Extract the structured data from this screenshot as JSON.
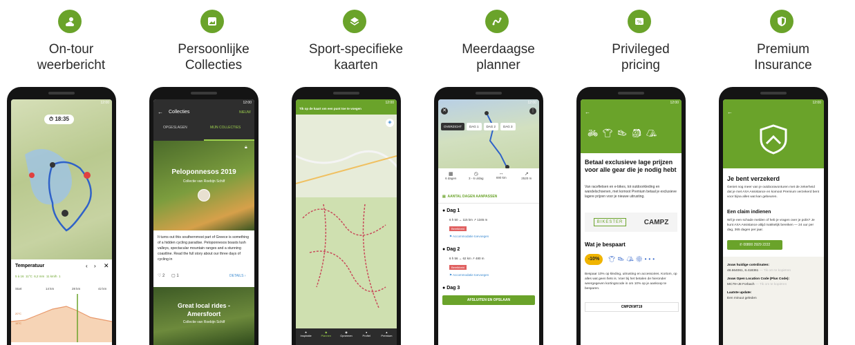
{
  "features": [
    {
      "icon": "weather-icon",
      "title_line1": "On-tour",
      "title_line2": "weerbericht"
    },
    {
      "icon": "collection-icon",
      "title_line1": "Persoonlijke",
      "title_line2": "Collecties"
    },
    {
      "icon": "layers-icon",
      "title_line1": "Sport-specifieke",
      "title_line2": "kaarten"
    },
    {
      "icon": "route-icon",
      "title_line1": "Meerdaagse",
      "title_line2": "planner"
    },
    {
      "icon": "discount-icon",
      "title_line1": "Privileged",
      "title_line2": "pricing"
    },
    {
      "icon": "shield-icon",
      "title_line1": "Premium",
      "title_line2": "Insurance"
    }
  ],
  "status_time": "12:00",
  "phone1": {
    "time_pill": "18:35",
    "panel_title": "Temperatuur",
    "stats": [
      "5 à 16",
      "11°C",
      "6,2 mm",
      "11 km/h",
      "1"
    ],
    "axis": [
      "Start",
      "14 km",
      "28 km",
      "42 km"
    ],
    "temp_labels": [
      "20°C",
      "15°C"
    ]
  },
  "phone2": {
    "header": "Collecties",
    "badge": "NIEUW",
    "tabs": [
      "OPGESLAGEN",
      "MIJN COLLECTIES"
    ],
    "card_title": "Peloponnesos 2019",
    "card_sub": "Collectie van Roebijn Schilf",
    "body": "It turns out this southernmost part of Greece is something of a hidden cycling paradise. Peloponnesos boasts lush valleys, spectacular mountain ranges and a stunning coastline. Read the full story about our three days of cycling in",
    "likes": "2",
    "comments": "1",
    "details": "DETAILS",
    "card2_title_l1": "Great local rides -",
    "card2_title_l2": "Amersfoort",
    "card2_sub": "Collectie van Roebijn Schilf"
  },
  "phone3": {
    "banner": "Tik op de kaart om een punt toe te voegen",
    "nav": [
      "Inspiratie",
      "Plannen",
      "Opnemen",
      "Profiel",
      "Premium"
    ]
  },
  "phone4": {
    "tabs": [
      "OVERZICHT",
      "DAG 1",
      "DAG 2",
      "DAG 3"
    ],
    "stats": [
      "6 dagen",
      "3 - 6 u/dag",
      "690 km",
      "2520 m"
    ],
    "adjust": "AANTAL DAGEN AANPASSEN",
    "days": [
      {
        "label": "Dag 1",
        "line": "6 h 50   ↔ 115 km   ↗ 1345 m",
        "tag": "Bereikbeid",
        "link": "Accommodatie toevoegen"
      },
      {
        "label": "Dag 2",
        "line": "6 h 56   ↔ 62 km   ↗ 480 m",
        "tag": "Bereikbeid",
        "link": "Accommodatie toevoegen"
      },
      {
        "label": "Dag 3"
      }
    ],
    "button": "AFSLUITEN EN OPSLAAN"
  },
  "phone5": {
    "heading": "Betaal exclusieve lage prijzen voor alle gear die je nodig hebt",
    "body": "Van racefietsen en e-bikes, tot outdoorkleding en wandelschoenen, met komoot Premium betaal je exclusieve lagere prijzen voor je nieuwe uitrusting.",
    "brands": [
      "BIKESTER",
      "CAMPZ"
    ],
    "saving_title": "Wat je bespaart",
    "discount": "-10%",
    "saving_body": "Bespaar 10% op kleding, uitrusting en accessoires. Kortom, op alles wat geen fiets is. Voer bij het betalen de hieronder weergegeven kortingscode in om 10% op je aankoop te besparen.",
    "code": "CMPZKMT19"
  },
  "phone6": {
    "heading": "Je bent verzekerd",
    "intro": "Geniet nog meer van je outdooravonturen met de zekerheid dat je met AXA Assistance en komoot Premium verzekerd bent voor bijna alles wat kan gebeuren.",
    "claim_title": "Een claim indienen",
    "claim_body": "Wil je een schade melden of heb je vragen over je polis? Je kunt AXA Assistance altijd makkelijk bereiken — 24 uur per dag, 365 dagen per jaar.",
    "phone": "00800 2929 2222",
    "coords_label": "Jouw huidige coördinaten:",
    "coords": "48.664061, 8.418361",
    "copy": "Tik om te kopiëren",
    "olc_label": "Jouw Open Location Code (Plus Code):",
    "olc": "MC79+J8 Forbach",
    "update_label": "Laatste update:",
    "update": "Een minuut geleden"
  }
}
